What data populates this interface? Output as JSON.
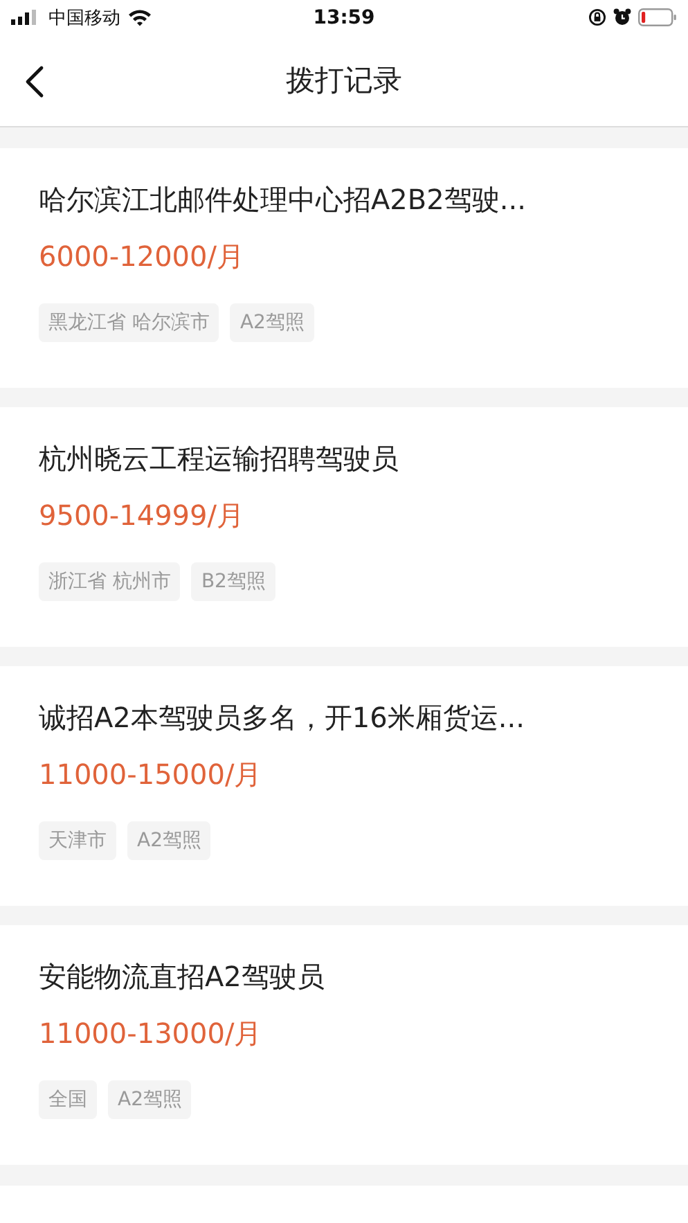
{
  "status_bar": {
    "carrier": "中国移动",
    "time": "13:59"
  },
  "nav": {
    "title": "拨打记录"
  },
  "jobs": [
    {
      "title": "哈尔滨江北邮件处理中心招A2B2驾驶...",
      "salary": "6000-12000/月",
      "tags": [
        "黑龙江省 哈尔滨市",
        "A2驾照"
      ]
    },
    {
      "title": "杭州晓云工程运输招聘驾驶员",
      "salary": "9500-14999/月",
      "tags": [
        "浙江省 杭州市",
        "B2驾照"
      ]
    },
    {
      "title": "诚招A2本驾驶员多名，开16米厢货运...",
      "salary": "11000-15000/月",
      "tags": [
        "天津市",
        "A2驾照"
      ]
    },
    {
      "title": "安能物流直招A2驾驶员",
      "salary": "11000-13000/月",
      "tags": [
        "全国",
        "A2驾照"
      ]
    }
  ]
}
